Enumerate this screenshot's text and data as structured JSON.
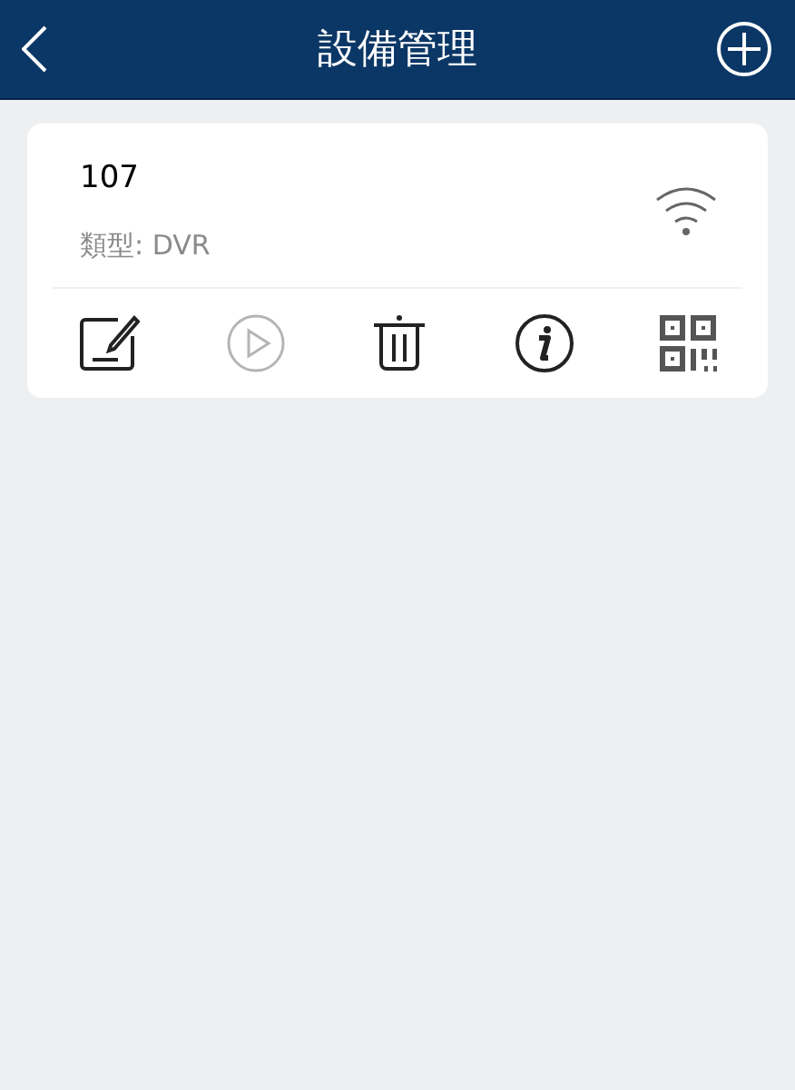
{
  "header": {
    "title": "設備管理"
  },
  "devices": [
    {
      "name": "107",
      "type_label": "類型: DVR",
      "actions": [
        {
          "kind": "edit",
          "disabled": false
        },
        {
          "kind": "play",
          "disabled": true
        },
        {
          "kind": "delete",
          "disabled": false
        },
        {
          "kind": "info",
          "disabled": false
        },
        {
          "kind": "qr",
          "disabled": false
        }
      ]
    }
  ]
}
